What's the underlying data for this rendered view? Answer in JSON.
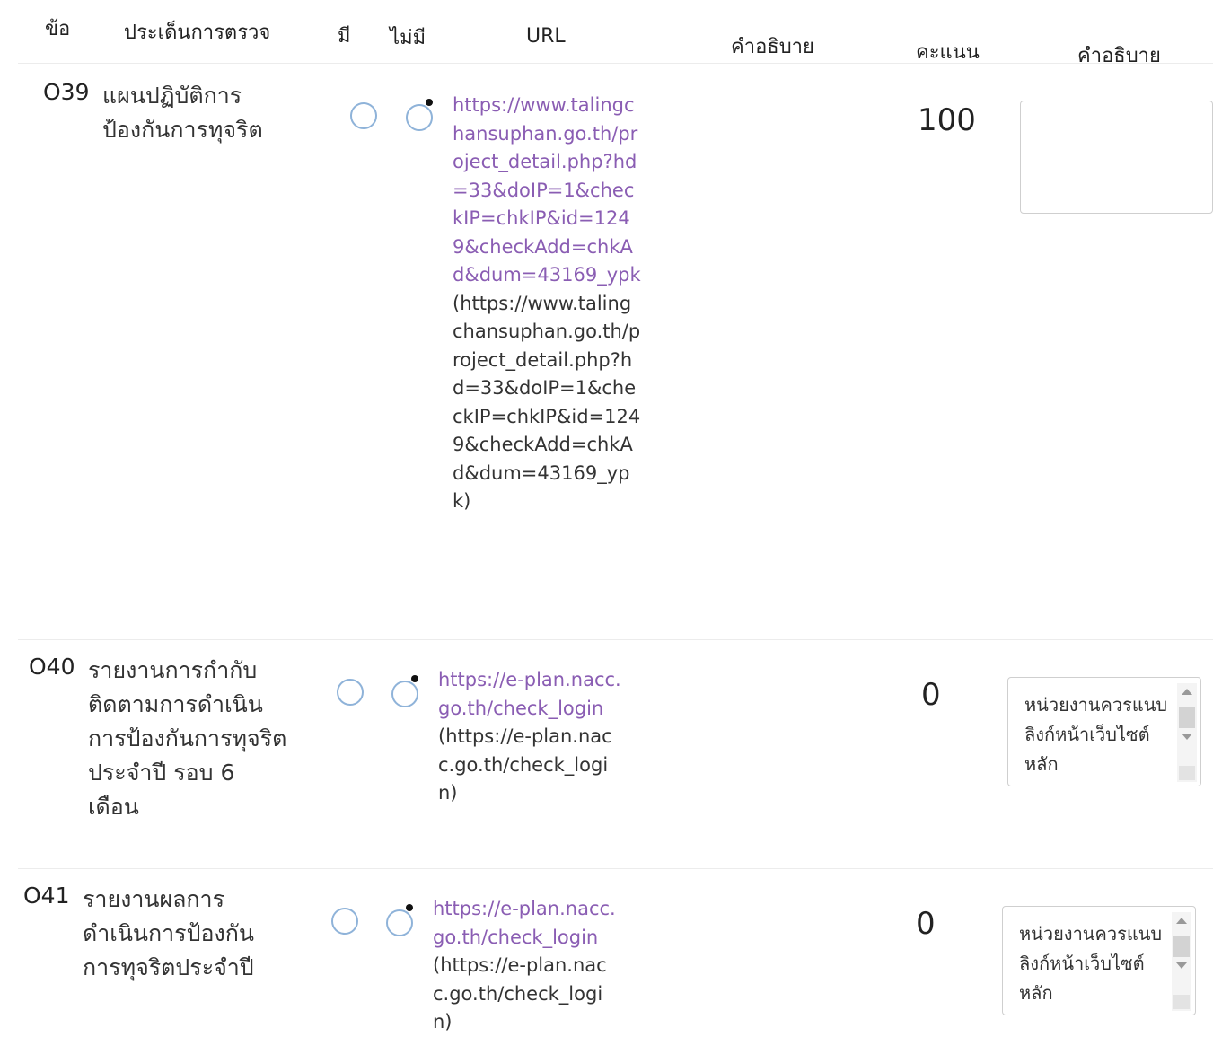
{
  "header": {
    "col_no": "ข้อ",
    "col_topic": "ประเด็นการตรวจ",
    "col_yes": "มี",
    "col_no_have": "ไม่มี",
    "col_url": "URL",
    "col_desc": "คำอธิบาย",
    "col_score": "คะแนน",
    "col_desc2": "คำอธิบาย"
  },
  "rows": [
    {
      "code": "O39",
      "topic": "แผนปฏิบัติการป้องกันการทุจริต",
      "selected": "ไม่มี",
      "url_link": "https://www.talingchansuphan.go.th/project_detail.php?hd=33&doIP=1&checkIP=chkIP&id=1249&checkAdd=chkAd&dum=43169_ypk",
      "url_text": "(https://www.talingchansuphan.go.th/project_detail.php?hd=33&doIP=1&checkIP=chkIP&id=1249&checkAdd=chkAd&dum=43169_ypk)",
      "score": "100",
      "comment": ""
    },
    {
      "code": "O40",
      "topic": "รายงานการกำกับติดตามการดำเนินการป้องกันการทุจริตประจำปี รอบ 6 เดือน",
      "selected": "ไม่มี",
      "url_link": "https://e-plan.nacc.go.th/check_login",
      "url_text": "(https://e-plan.nacc.go.th/check_login)",
      "score": "0",
      "comment": "หน่วยงานควรแนบลิงก์หน้าเว็บไซต์หลัก"
    },
    {
      "code": "O41",
      "topic": "รายงานผลการดำเนินการป้องกันการทุจริตประจำปี",
      "selected": "ไม่มี",
      "url_link": "https://e-plan.nacc.go.th/check_login",
      "url_text": "(https://e-plan.nacc.go.th/check_login)",
      "score": "0",
      "comment": "หน่วยงานควรแนบลิงก์หน้าเว็บไซต์หลัก"
    }
  ]
}
